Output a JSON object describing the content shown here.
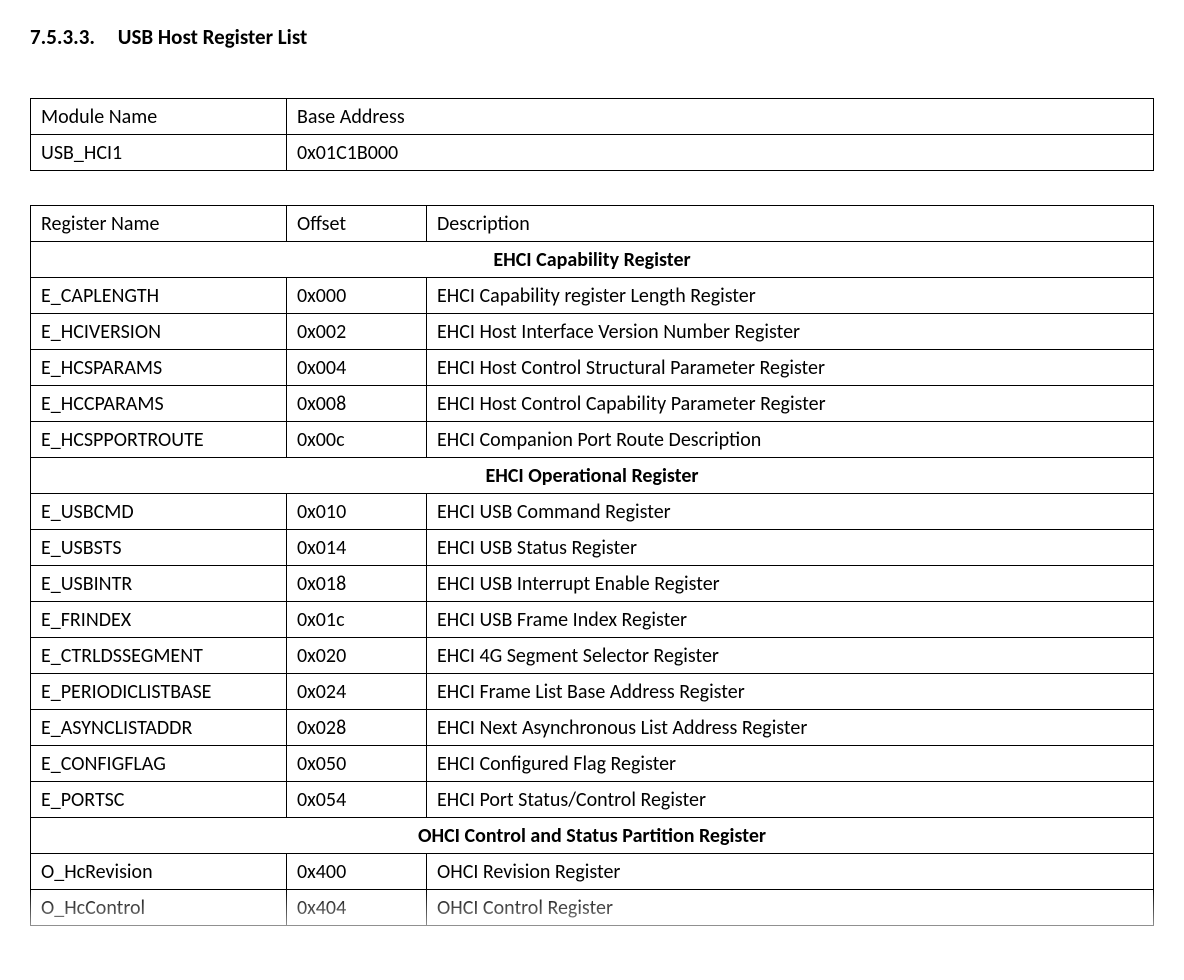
{
  "heading": {
    "number": "7.5.3.3.",
    "title": "USB Host Register List"
  },
  "module_table": {
    "headers": {
      "name": "Module Name",
      "base": "Base Address"
    },
    "rows": [
      {
        "name": "USB_HCI1",
        "base": "0x01C1B000"
      }
    ]
  },
  "register_table": {
    "headers": {
      "name": "Register Name",
      "offset": "Offset",
      "desc": "Description"
    },
    "sections": [
      {
        "title": "EHCI Capability Register",
        "rows": [
          {
            "name": "E_CAPLENGTH",
            "offset": "0x000",
            "desc": "EHCI Capability register Length Register"
          },
          {
            "name": "E_HCIVERSION",
            "offset": "0x002",
            "desc": "EHCI Host Interface Version Number Register"
          },
          {
            "name": "E_HCSPARAMS",
            "offset": "0x004",
            "desc": "EHCI Host Control Structural Parameter Register"
          },
          {
            "name": "E_HCCPARAMS",
            "offset": "0x008",
            "desc": "EHCI Host Control Capability Parameter Register"
          },
          {
            "name": "E_HCSPPORTROUTE",
            "offset": "0x00c",
            "desc": "EHCI Companion Port Route Description"
          }
        ]
      },
      {
        "title": "EHCI Operational Register",
        "rows": [
          {
            "name": "E_USBCMD",
            "offset": "0x010",
            "desc": "EHCI USB Command Register"
          },
          {
            "name": "E_USBSTS",
            "offset": "0x014",
            "desc": "EHCI USB Status Register"
          },
          {
            "name": "E_USBINTR",
            "offset": "0x018",
            "desc": "EHCI USB Interrupt Enable Register"
          },
          {
            "name": "E_FRINDEX",
            "offset": "0x01c",
            "desc": "EHCI USB Frame Index Register"
          },
          {
            "name": "E_CTRLDSSEGMENT",
            "offset": "0x020",
            "desc": "EHCI 4G Segment Selector Register"
          },
          {
            "name": "E_PERIODICLISTBASE",
            "offset": "0x024",
            "desc": "EHCI Frame List Base Address Register"
          },
          {
            "name": "E_ASYNCLISTADDR",
            "offset": "0x028",
            "desc": "EHCI Next Asynchronous List Address Register"
          },
          {
            "name": "E_CONFIGFLAG",
            "offset": "0x050",
            "desc": "EHCI Configured Flag Register"
          },
          {
            "name": "E_PORTSC",
            "offset": "0x054",
            "desc": "EHCI Port Status/Control Register"
          }
        ]
      },
      {
        "title": "OHCI Control and Status Partition Register",
        "rows": [
          {
            "name": "O_HcRevision",
            "offset": "0x400",
            "desc": "OHCI Revision Register"
          },
          {
            "name": "O_HcControl",
            "offset": "0x404",
            "desc": "OHCI Control Register"
          }
        ]
      }
    ]
  }
}
